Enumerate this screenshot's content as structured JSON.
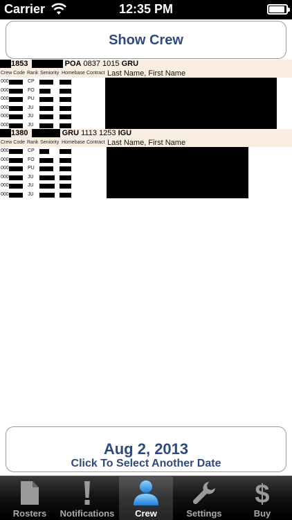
{
  "status_bar": {
    "carrier": "Carrier",
    "time": "12:35 PM"
  },
  "show_crew_button": "Show Crew",
  "flights": [
    {
      "flight_no": "1853",
      "origin": "POA",
      "times": "0837 1015",
      "dest": "GRU",
      "columns": {
        "code": "Crew Code",
        "rank": "Rank",
        "seniority": "Seniority",
        "homebase": "Homebase",
        "contract": "Contract",
        "name": "Last Name, First Name"
      },
      "crew": [
        {
          "code": "000",
          "rank": "CP"
        },
        {
          "code": "000",
          "rank": "FO"
        },
        {
          "code": "000",
          "rank": "PU"
        },
        {
          "code": "000",
          "rank": "JU"
        },
        {
          "code": "000",
          "rank": "JU"
        },
        {
          "code": "000",
          "rank": "JU"
        }
      ]
    },
    {
      "flight_no": "1380",
      "origin": "GRU",
      "times": "1113 1253",
      "dest": "IGU",
      "columns": {
        "code": "Crew Code",
        "rank": "Rank",
        "seniority": "Seniority",
        "homebase": "Homebase",
        "contract": "Contract",
        "name": "Last Name, First Name"
      },
      "crew": [
        {
          "code": "000",
          "rank": "CP"
        },
        {
          "code": "000",
          "rank": "FO"
        },
        {
          "code": "000",
          "rank": "PU"
        },
        {
          "code": "000",
          "rank": "JU"
        },
        {
          "code": "000",
          "rank": "JU"
        },
        {
          "code": "000",
          "rank": "JU"
        }
      ]
    }
  ],
  "date_button": {
    "date": "Aug 2, 2013",
    "subtitle": "Click To Select Another Date"
  },
  "tabs": [
    {
      "label": "Rosters",
      "icon": "document-icon"
    },
    {
      "label": "Notifications",
      "icon": "exclamation-icon"
    },
    {
      "label": "Crew",
      "icon": "person-icon",
      "active": true
    },
    {
      "label": "Settings",
      "icon": "wrench-icon"
    },
    {
      "label": "Buy",
      "icon": "dollar-icon"
    }
  ]
}
